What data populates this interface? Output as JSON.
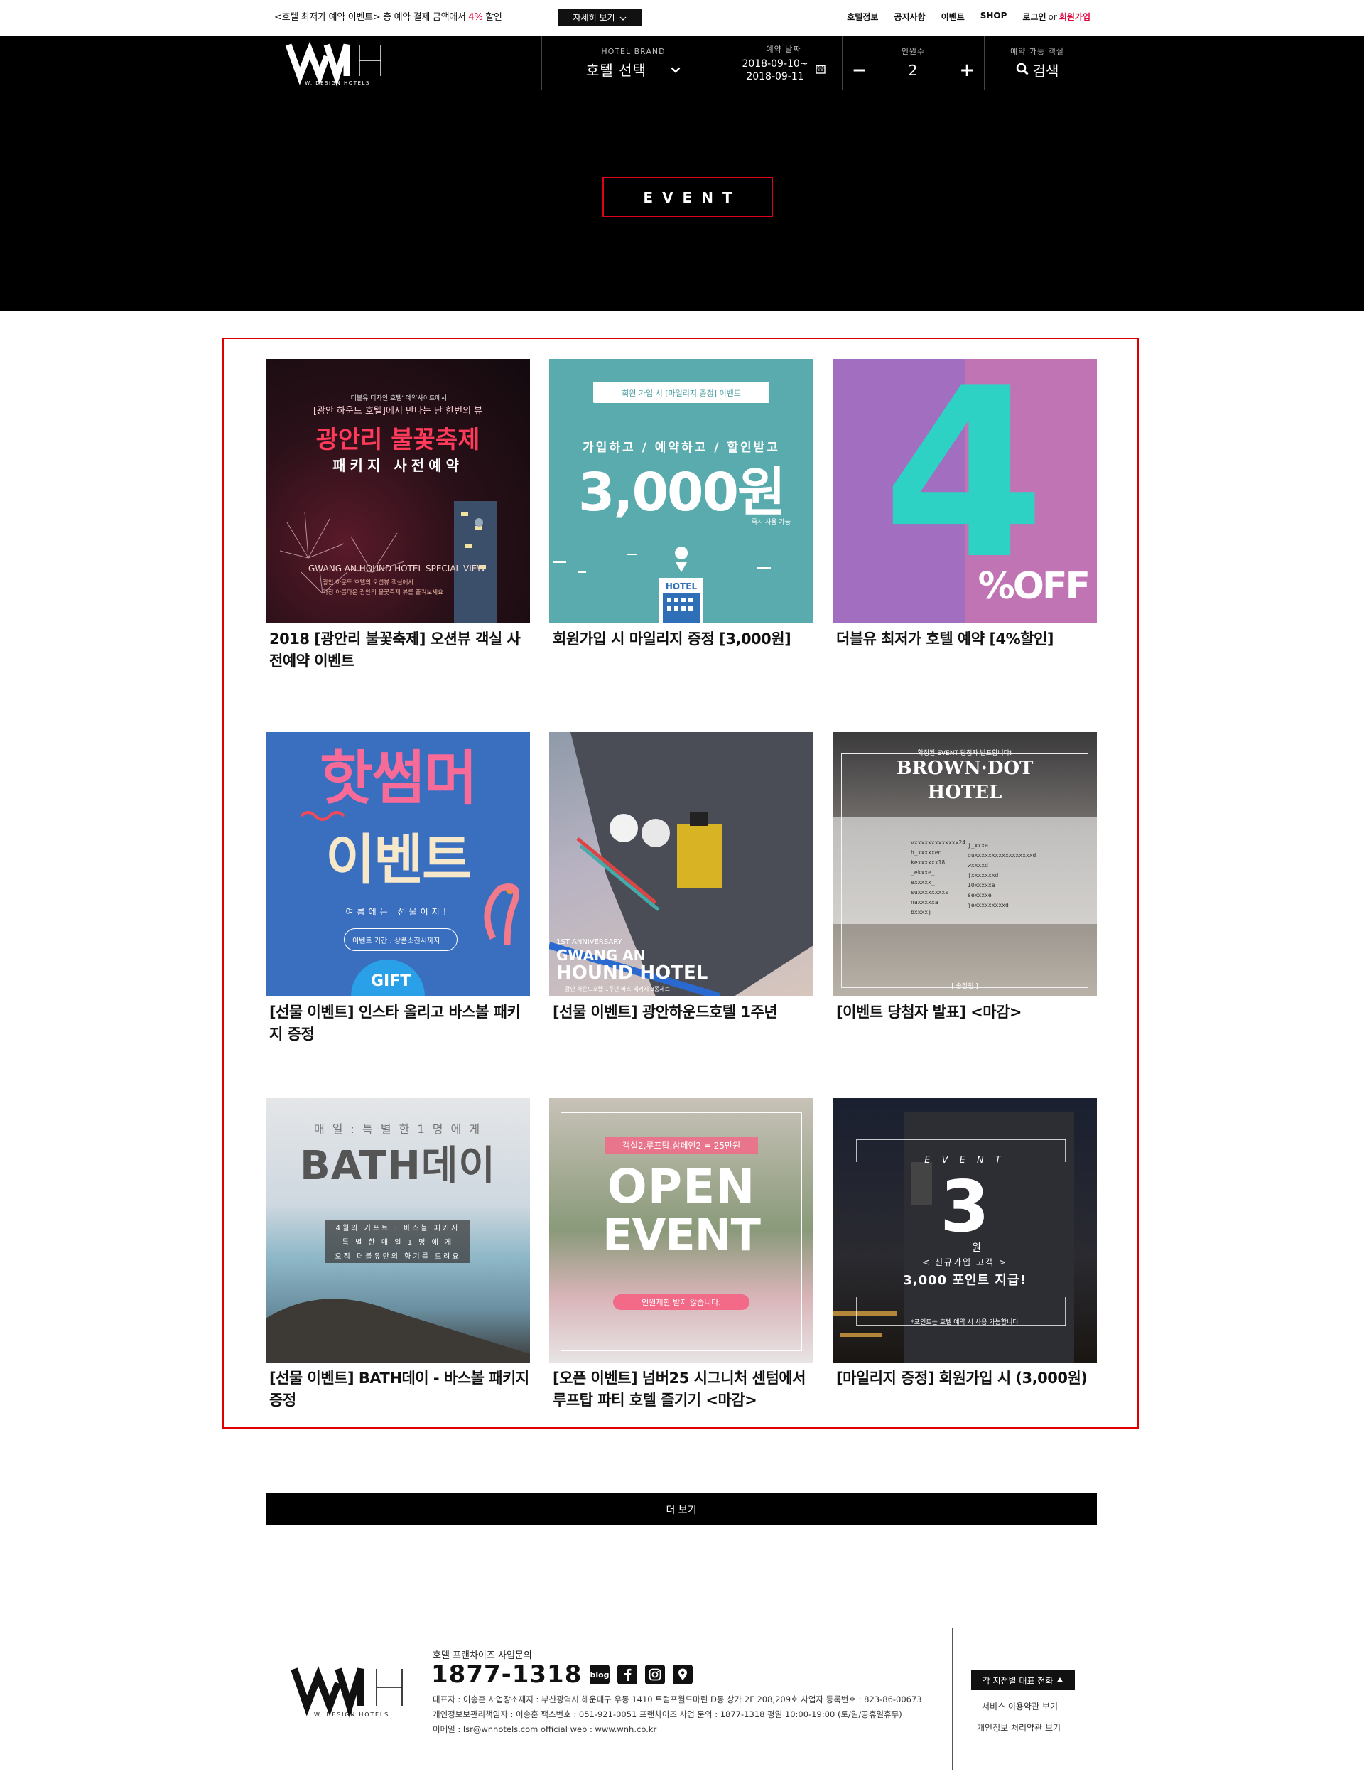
{
  "topbar": {
    "promo_prefix": "<호텔 최저가 예약 이벤트> 총 예약 결제 금액에서 ",
    "promo_highlight": "4%",
    "promo_suffix": " 할인",
    "detail_label": "자세히 보기",
    "nav": {
      "hotel_info": "호텔정보",
      "notice": "공지사항",
      "event": "이벤트",
      "shop": "SHOP",
      "login": "로그인",
      "or": "or",
      "signup": "회원가입"
    }
  },
  "header": {
    "logo_text": "W. DESIGN HOTELS",
    "brand_caption": "HOTEL BRAND",
    "brand_value": "호텔 선택",
    "date_caption": "예약 날짜",
    "date_from": "2018-09-10~",
    "date_to": "2018-09-11",
    "people_caption": "인원수",
    "people_minus": "−",
    "people_value": "2",
    "people_plus": "+",
    "search_caption": "예약 가능 객실",
    "search_label": "검색"
  },
  "hero": {
    "event_label": "EVENT"
  },
  "events": [
    {
      "title": "2018 [광안리 불꽃축제] 오션뷰 객실 사전예약 이벤트",
      "img": {
        "l1": "'더블유 디자인 호텔' 예약사이트에서",
        "l2": "[광안 하운드 호텔]에서 만나는 단 한번의 뷰",
        "l3": "광안리 불꽃축제",
        "l4": "패키지 사전예약",
        "l5": "GWANG AN HOUND HOTEL SPECIAL VIEW",
        "l6": "광안 하운드 호텔의 오션뷰 객실에서",
        "l7": "가장 아름다운 광안리 불꽃축제 뷰를 즐겨보세요"
      }
    },
    {
      "title": "회원가입 시 마일리지 증정 [3,000원]",
      "img": {
        "l1": "회원 가입 시 [마일리지 증정] 이벤트",
        "l2": "가입하고 / 예약하고 / 할인받고",
        "l3": "3,000원",
        "l4": "즉시 사용 가능",
        "l5": "HOTEL"
      }
    },
    {
      "title": "더블유 최저가 호텔 예약 [4%할인]",
      "img": {
        "l1": "4",
        "l2": "%OFF"
      }
    },
    {
      "title": "[선물 이벤트] 인스타 올리고 바스볼 패키지 증정",
      "img": {
        "l1": "핫썸머",
        "l2": "이벤트",
        "l3": "여름에는 선물이지!",
        "l4": "이벤트 기간 : 상품소진시까지",
        "l5": "GIFT"
      }
    },
    {
      "title": "[선물 이벤트] 광안하운드호텔 1주년",
      "img": {
        "l1": "1ST ANNIVERSARY",
        "l2": "GWANG AN",
        "l3": "HOUND HOTEL",
        "l4": "광안 하운드호텔 1주년 바스 패키지 3종세트"
      }
    },
    {
      "title": "[이벤트 당첨자 발표] <마감>",
      "img": {
        "l1": "확정된 EVENT 당첨자 발표합니다!",
        "l2": "BROWN·DOT",
        "l3": "HOTEL",
        "l4": "[ 송정점 ]"
      }
    },
    {
      "title": "[선물 이벤트] BATH데이 - 바스볼 패키지 증정",
      "img": {
        "l1": "매 일 : 특 별 한  1 명 에 게",
        "l2": "BATH데이",
        "l3": "4월의 기프트 : 바스볼 패키지",
        "l4": "특 별 한 매 일 1 명 에 게",
        "l5": "오직 더블유만의 향기를 드려요"
      }
    },
    {
      "title": "[오픈 이벤트] 넘버25 시그니처 센텀에서 루프탑 파티 호텔 즐기기 <마감>",
      "img": {
        "l1": "객실2,루프탑,삼페인2 = 25만원",
        "l2": "OPEN",
        "l3": "EVENT",
        "l4": "인원제한 받지 않습니다."
      }
    },
    {
      "title": "[마일리지 증정] 회원가입 시 (3,000원)",
      "img": {
        "l1": "E V E N T",
        "l2": "3",
        "l3": "원",
        "l4": "< 신규가입 고객 >",
        "l5": "3,000 포인트 지급!",
        "l6": "*포인트는 호텔 예약 시 사용 가능합니다"
      }
    }
  ],
  "more_label": "더 보기",
  "footer": {
    "logo_text": "W. DESIGN HOTELS",
    "sub": "호텔 프랜차이즈 사업문의",
    "phone": "1877-1318",
    "icons": [
      "blog-icon",
      "facebook-icon",
      "instagram-icon",
      "map-pin-icon"
    ],
    "info1": "대표자 : 이송훈   사업장소재지 : 부산광역시 해운대구 우동 1410 트럼프월드마린 D동 상가 2F 208,209호   사업자 등록번호 : 823-86-00673",
    "info2": "개인정보보관리책임자 : 이송훈   팩스번호 : 051-921-0051   프랜차이즈 사업 문의 : 1877-1318   평일 10:00-19:00 (토/일/공휴일휴무)",
    "info3": "이메일 : lsr@wnhotels.com    official web : www.wnh.co.kr",
    "switch_label": "각 지점별 대표 전화",
    "terms": "서비스 이용약관 보기",
    "privacy": "개인정보 처리약관 보기"
  }
}
